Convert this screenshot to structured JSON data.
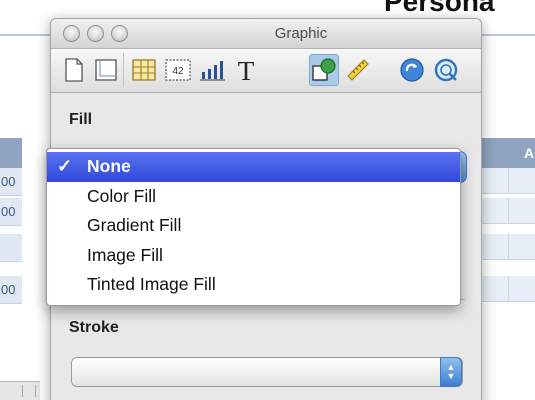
{
  "background": {
    "doc_title": "Persona",
    "left_cells": [
      "00",
      "00",
      "",
      "00"
    ],
    "right_header": "A"
  },
  "window": {
    "title": "Graphic"
  },
  "toolbar": {
    "tools": [
      {
        "icon": "document-icon"
      },
      {
        "icon": "layout-icon"
      },
      {
        "icon": "table-icon"
      },
      {
        "icon": "cell-format-icon",
        "text": "42"
      },
      {
        "icon": "chart-icon"
      },
      {
        "icon": "text-icon",
        "text": "T"
      },
      {
        "icon": "graphic-icon",
        "selected": true
      },
      {
        "icon": "ruler-icon"
      },
      {
        "icon": "link-icon"
      },
      {
        "icon": "quicktime-icon"
      }
    ]
  },
  "fill": {
    "label": "Fill",
    "options": [
      {
        "label": "None",
        "selected": true
      },
      {
        "label": "Color Fill"
      },
      {
        "label": "Gradient Fill"
      },
      {
        "label": "Image Fill"
      },
      {
        "label": "Tinted Image Fill"
      }
    ],
    "check_mark": "✓"
  },
  "stroke": {
    "label": "Stroke",
    "value": ""
  },
  "colors": {
    "menu_highlight": "#3b55e2",
    "selected_tool": "#a9cbe9",
    "popup_arrow": "#3b7fd4",
    "table_header": "#8ea4c0"
  }
}
